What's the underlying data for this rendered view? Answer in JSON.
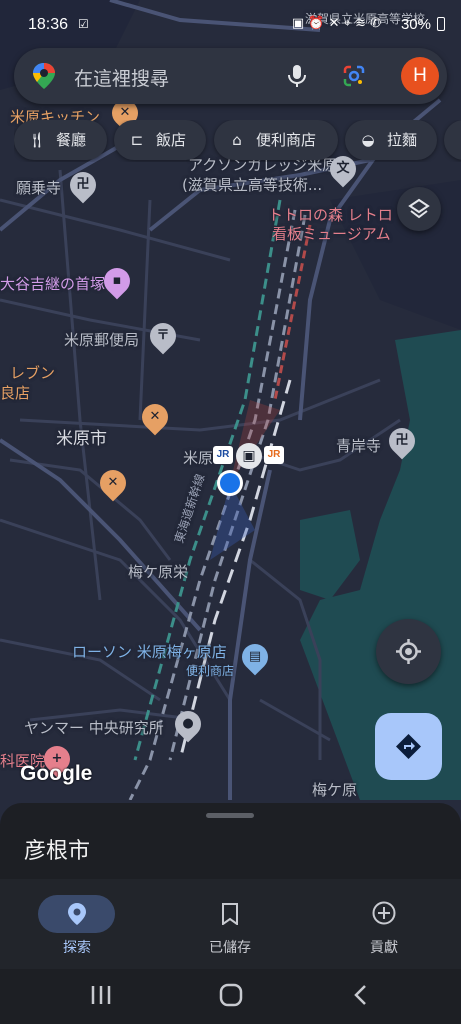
{
  "status_bar": {
    "time": "18:36",
    "battery": "30%"
  },
  "search": {
    "placeholder": "在這裡搜尋",
    "avatar_letter": "H"
  },
  "chips": [
    {
      "label": "餐廳",
      "icon": "fork-knife-icon"
    },
    {
      "label": "飯店",
      "icon": "bed-icon"
    },
    {
      "label": "便利商店",
      "icon": "store-icon"
    },
    {
      "label": "拉麵",
      "icon": "ramen-bowl-icon"
    }
  ],
  "map": {
    "labels": {
      "kitchen": "米原キッチン",
      "top_cut": "滋賀県立米原高等学校",
      "school_line1": "アクソンガレッジ米原",
      "school_line2": "(滋賀県立高等技術...",
      "ganjoji": "願乗寺",
      "totoro_line1": "トトロの森 レトロ",
      "totoro_line2": "看板ミュージアム",
      "otani": "大谷吉継の首塚",
      "post": "米原郵便局",
      "seven_line1": "レブン",
      "seven_line2": "良店",
      "city": "米原市",
      "station": "米原",
      "shinkansen": "東海道新幹線",
      "seiganji": "青岸寺",
      "umegahara_sakae": "梅ケ原栄",
      "lawson": "ローソン 米原梅ヶ原店",
      "lawson_sub": "便利商店",
      "yanmar": "ヤンマー 中央研究所",
      "hospital": "科医院",
      "umegahara": "梅ケ原"
    }
  },
  "branding": {
    "google": "Google"
  },
  "sheet": {
    "title": "彦根市"
  },
  "bottom_nav": [
    {
      "label": "探索",
      "icon": "location-pin-icon",
      "active": true
    },
    {
      "label": "已儲存",
      "icon": "bookmark-icon",
      "active": false
    },
    {
      "label": "貢獻",
      "icon": "add-circle-icon",
      "active": false
    }
  ],
  "colors": {
    "accent": "#a8c7fa",
    "avatar": "#e8511f",
    "location_dot": "#1a73e8"
  }
}
